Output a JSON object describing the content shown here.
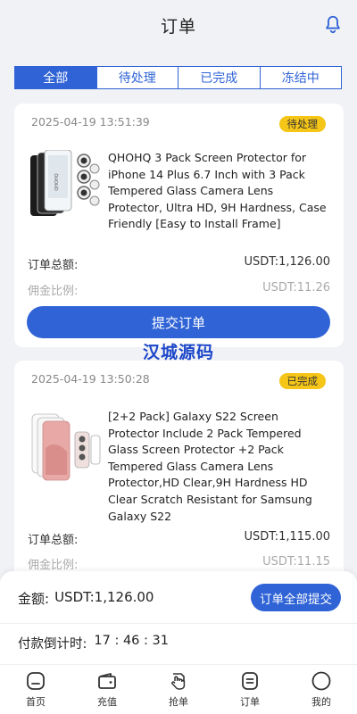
{
  "header": {
    "title": "订单"
  },
  "tabs": [
    {
      "label": "全部"
    },
    {
      "label": "待处理"
    },
    {
      "label": "已完成"
    },
    {
      "label": "冻结中"
    }
  ],
  "orders": [
    {
      "time": "2025-04-19 13:51:39",
      "status": "待处理",
      "name": "QHOHQ 3 Pack Screen Protector for iPhone 14 Plus 6.7 Inch with 3 Pack Tempered Glass Camera Lens Protector, Ultra HD, 9H Hardness, Case Friendly [Easy to Install Frame]",
      "total_label": "订单总额:",
      "total_value": "USDT:1,126.00",
      "commission_label": "佣金比例:",
      "commission_value": "USDT:11.26",
      "submit_label": "提交订单"
    },
    {
      "time": "2025-04-19 13:50:28",
      "status": "已完成",
      "name": "[2+2 Pack] Galaxy S22 Screen Protector Include 2 Pack Tempered Glass Screen Protector +2 Pack Tempered Glass Camera Lens Protector,HD Clear,9H Hardness HD Clear Scratch Resistant for Samsung Galaxy S22",
      "total_label": "订单总额:",
      "total_value": "USDT:1,115.00",
      "commission_label": "佣金比例:",
      "commission_value": "USDT:11.15"
    }
  ],
  "watermark": "汉城源码",
  "summary": {
    "amount_label": "金额:",
    "amount_value": "USDT:1,126.00",
    "submit_all_label": "订单全部提交",
    "countdown_label": "付款倒计时:",
    "countdown_value": "17 : 46 : 31"
  },
  "nav": [
    {
      "label": "首页",
      "icon": "home-icon"
    },
    {
      "label": "充值",
      "icon": "wallet-icon"
    },
    {
      "label": "抢单",
      "icon": "grab-order-icon"
    },
    {
      "label": "订单",
      "icon": "order-icon"
    },
    {
      "label": "我的",
      "icon": "profile-icon"
    }
  ],
  "colors": {
    "accent": "#2f63d6",
    "badge": "#f5c518",
    "background": "#f1f2f5",
    "watermark": "#1c47c9"
  }
}
